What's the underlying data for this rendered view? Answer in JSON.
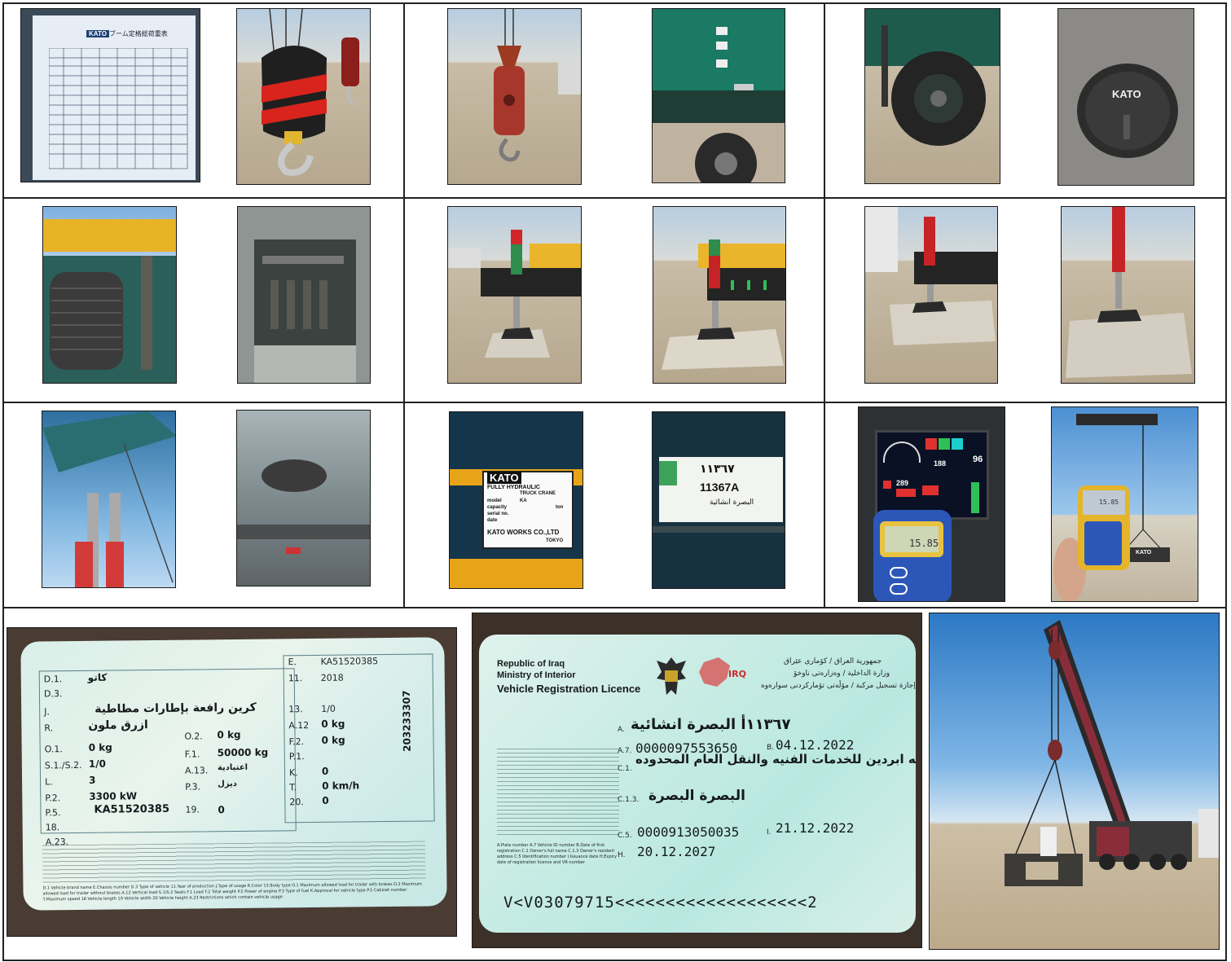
{
  "photos": {
    "load_chart": {
      "brand": "KATO",
      "title": "ブーム定格総荷重表"
    },
    "wheel_cap": {
      "brand": "KATO"
    },
    "nameplate": {
      "brand": "KATO",
      "line1": "FULLY HYDRAULIC",
      "line2": "TRUCK CRANE",
      "model_label": "model",
      "model_value": "KA",
      "capacity_label": "capacity",
      "capacity_unit": "ton",
      "serial_label": "serial no.",
      "date_label": "date",
      "maker": "KATO WORKS CO.,LTD",
      "city": "TOKYO"
    },
    "plate": {
      "arabic_number": "١١٣٦٧",
      "latin_number": "11367A",
      "city": "البصرة انشائية"
    },
    "monitor": {
      "value1": "188",
      "value2": "96",
      "value3": "289",
      "meter_reading": "15.85"
    },
    "meter2": {
      "meter_reading": "15.85",
      "weight_brand": "KATO"
    }
  },
  "card_back": {
    "rows": [
      {
        "code": "D.1.",
        "value": "كاتو"
      },
      {
        "code": "D.3.",
        "value": ""
      },
      {
        "code": "J.",
        "value": "كرين رافعة بإطارات مطاطية"
      },
      {
        "code": "R.",
        "value": "ازرق ملون"
      },
      {
        "code": "O.1.",
        "value": "0 kg"
      },
      {
        "code": "S.1./S.2.",
        "value": "1/0"
      },
      {
        "code": "L.",
        "value": "3"
      },
      {
        "code": "P.2.",
        "value": "3300 kW"
      },
      {
        "code": "P.5.",
        "value": "KA51520385"
      },
      {
        "code": "18.",
        "value": ""
      },
      {
        "code": "A.23.",
        "value": ""
      }
    ],
    "mid": [
      {
        "code": "O.2.",
        "value": "0 kg"
      },
      {
        "code": "F.1.",
        "value": "50000 kg"
      },
      {
        "code": "A.13.",
        "value": "اعتيادية"
      },
      {
        "code": "P.3.",
        "value": "ديزل"
      },
      {
        "code": "19.",
        "value": "0"
      }
    ],
    "right": [
      {
        "code": "E.",
        "value": "KA51520385"
      },
      {
        "code": "11.",
        "value": "2018"
      },
      {
        "code": "13.",
        "value": "1/0"
      },
      {
        "code": "A.12",
        "value": "0 kg"
      },
      {
        "code": "F.2.",
        "value": "0 kg"
      },
      {
        "code": "P.1.",
        "value": ""
      },
      {
        "code": "K.",
        "value": "0"
      },
      {
        "code": "T.",
        "value": "0 km/h"
      },
      {
        "code": "20.",
        "value": "0"
      }
    ],
    "vertical_number": "203233307",
    "footer": "D.1 Vehicle brand name  E.Chassis number  D.3 Type of vehicle  11.Year of production  J.Type of usage  R.Color  13.Body type  O.1 Maximum allowed load for trailer with brakes  O.2 Maximum allowed load for trailer without brakes  A.12 Vertical load  S.1/S.2 Seats  F.1 Load  F.2 Total weight  P.2 Power of engine  P.3 Type of fuel  K.Approval for vehicle type  P.5 Cabinet number  T.Maximum speed  18 Vehicle length  19 Vehicle width  20 Vehicle height  A.23 Restrictions which contain vehicle usage"
  },
  "licence": {
    "country": "Republic of Iraq",
    "ministry": "Ministry of Interior",
    "title": "Vehicle Registration Licence",
    "irq": "IRQ",
    "ar_country": "جمهورية العراق / كۆماری عێراق",
    "ar_ministry": "وزارة الداخلية / وەزارەتی ناوخۆ",
    "ar_title": "إجازة تسجيل مركبة / مۆڵەتی تۆمارکردنی سوارەوە",
    "plate_line": "١١٣٦٧أ البصرة انشائية",
    "a_label": "A.",
    "a7_label": "A.7.",
    "a7_value": "0000097553650",
    "b_label": "B.",
    "b_value": "04.12.2022",
    "c1_label": "C.1.",
    "owner": "شركه ابردين للخدمات الفنيه والنقل العام المحدوده",
    "c13_label": "C.1.3.",
    "address": "البصرة البصرة",
    "c5_label": "C.5.",
    "c5_value": "0000913050035",
    "i_label": "I.",
    "i_value": "21.12.2022",
    "h_label": "H.",
    "h_value": "20.12.2027",
    "mrz": "V<V03079715<<<<<<<<<<<<<<<<<<<2",
    "footnote": "A.Plate number  A.7 Vehicle ID number  B.Date of first registration  C.1 Owner's full name  C.1.3 Owner's resident address  C.5 Identification number  I.Issuance date  H.Expiry date of registration licence and VR number"
  }
}
